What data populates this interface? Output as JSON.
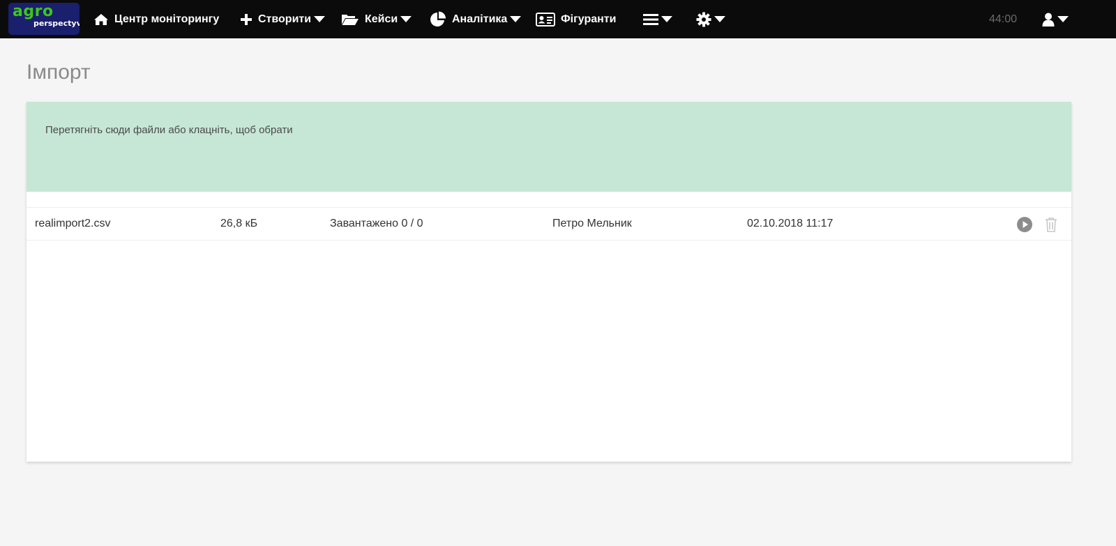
{
  "app": {
    "logo_line1": "agro",
    "logo_line2": "perspectyva"
  },
  "nav": {
    "monitoring_label": "Центр моніторингу",
    "create_label": "Створити",
    "cases_label": "Кейси",
    "analytics_label": "Аналітика",
    "figurants_label": "Фігуранти"
  },
  "session": {
    "timer": "44:00"
  },
  "page": {
    "title": "Імпорт"
  },
  "dropzone": {
    "text": "Перетягніть сюди файли або клацніть, щоб обрати"
  },
  "files": [
    {
      "name": "realimport2.csv",
      "size": "26,8 кБ",
      "status": "Завантажено 0 / 0",
      "user": "Петро Мельник",
      "date": "02.10.2018 11:17"
    }
  ],
  "colors": {
    "navbar_bg": "#0b0b0b",
    "logo_bg": "#1a1f6e",
    "logo_accent": "#3ec61c",
    "dropzone_bg": "#c6e7d5",
    "page_bg": "#f5f5f5",
    "action_icon": "#8c8c8c"
  }
}
